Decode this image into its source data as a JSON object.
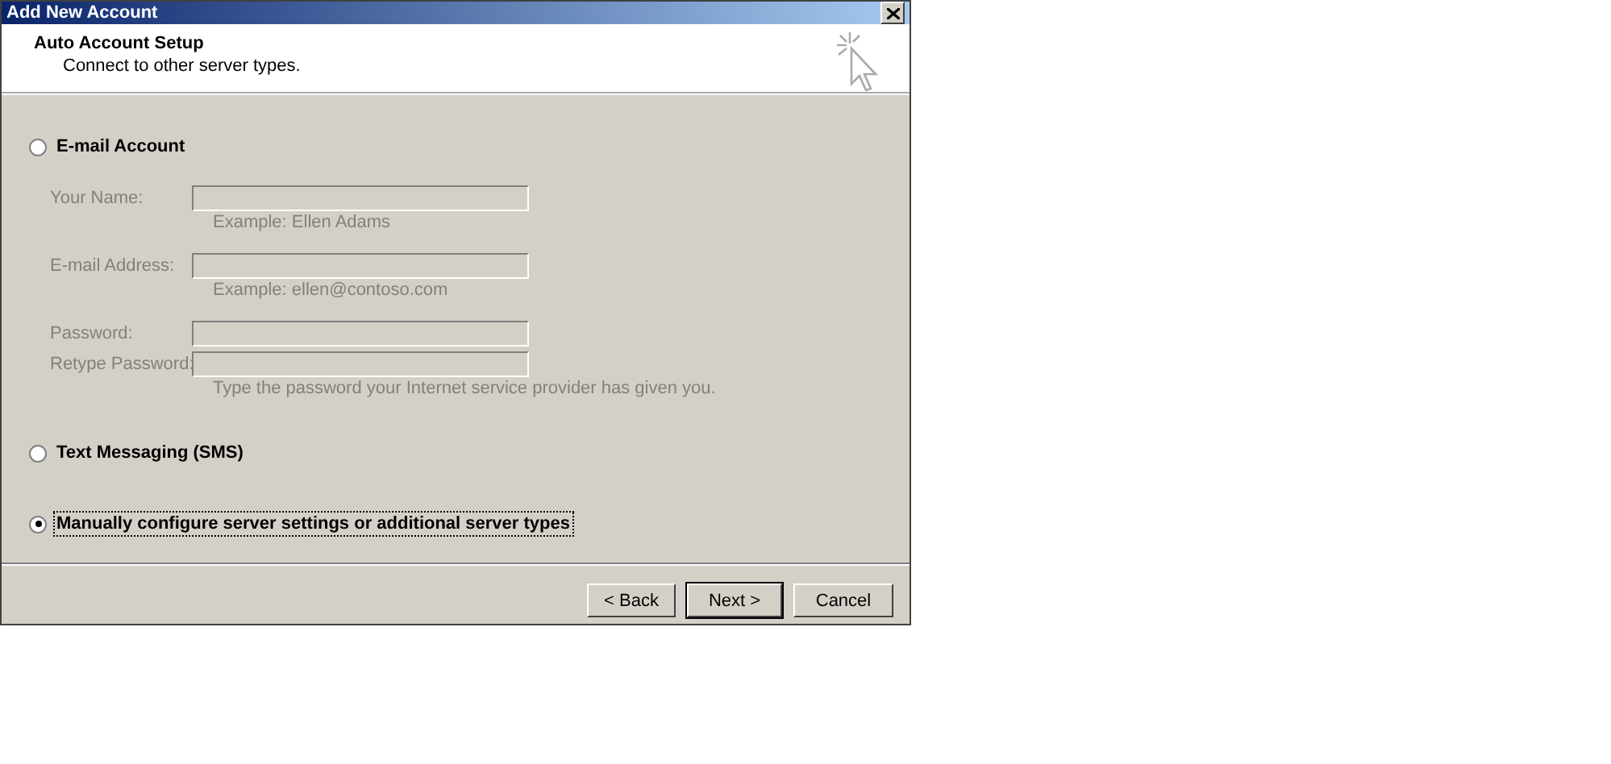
{
  "window": {
    "title": "Add New Account"
  },
  "header": {
    "title": "Auto Account Setup",
    "subtitle": "Connect to other server types."
  },
  "options": [
    {
      "label": "E-mail Account",
      "selected": false,
      "disabled": false,
      "fields": [
        {
          "label": "Your Name:",
          "disabled": true,
          "hint": "Example: Ellen Adams"
        },
        {
          "label": "E-mail Address:",
          "disabled": true,
          "hint": "Example: ellen@contoso.com"
        },
        {
          "label": "Password:",
          "disabled": true
        },
        {
          "label": "Retype Password:",
          "disabled": true,
          "hint": "Type the password your Internet service provider has given you."
        }
      ]
    },
    {
      "label": "Text Messaging (SMS)",
      "selected": false,
      "disabled": false
    },
    {
      "label": "Manually configure server settings or additional server types",
      "selected": true,
      "disabled": false
    }
  ],
  "buttons": [
    {
      "label": "< Back",
      "default": false
    },
    {
      "label": "Next >",
      "default": true
    },
    {
      "label": "Cancel",
      "default": false
    }
  ]
}
